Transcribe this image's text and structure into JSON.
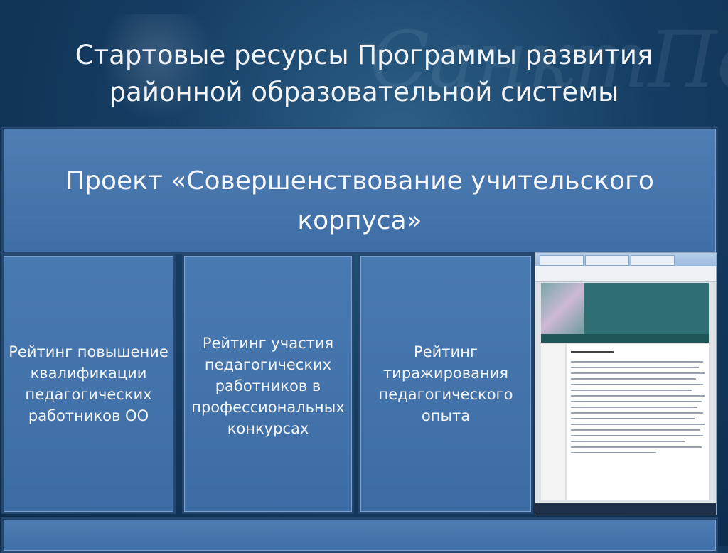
{
  "slide": {
    "title_line1": "Стартовые ресурсы Программы развития",
    "title_line2": "районной образовательной системы",
    "project_line1": "Проект  «Совершенствование учительского",
    "project_line2": "корпуса»"
  },
  "boxes": [
    {
      "lines": [
        "Рейтинг повышение",
        "квалификации",
        "педагогических",
        "работников ОО"
      ]
    },
    {
      "lines": [
        "Рейтинг участия",
        "педагогических",
        "работников в",
        "профессиональных",
        "конкурсах"
      ]
    },
    {
      "lines": [
        "Рейтинг",
        "тиражирования",
        "педагогического",
        "опыта"
      ]
    }
  ],
  "screenshot": {
    "description_icon": "website-screenshot"
  }
}
